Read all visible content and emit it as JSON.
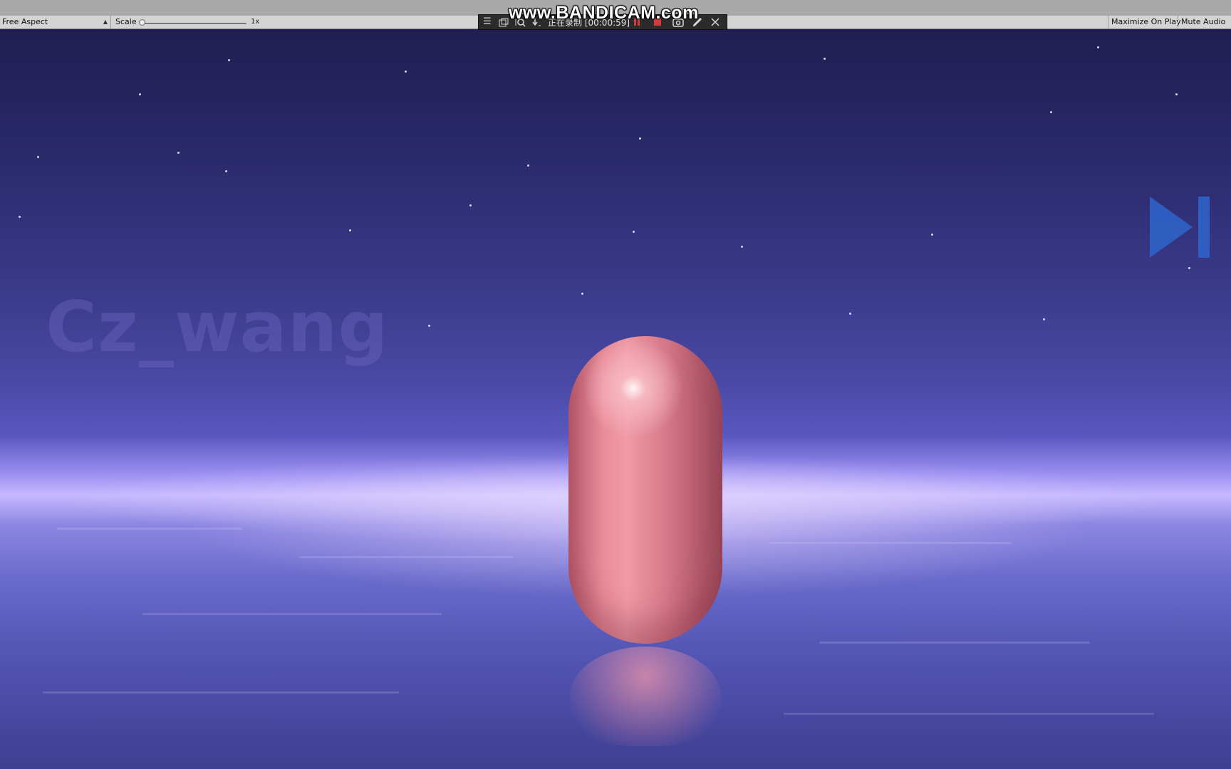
{
  "toolbar": {
    "aspect_label": "Free Aspect",
    "scale_label": "Scale",
    "scale_value": "1x",
    "maximize_label": "Maximize On Play",
    "mute_label": "Mute Audio"
  },
  "recorder": {
    "logo": "www.BANDICAM.com",
    "status": "正在录制 [00:00:59]"
  },
  "scene": {
    "watermark": "Cz_wang"
  },
  "icons": [
    "menu-icon",
    "window-icon",
    "search-icon",
    "download-icon",
    "pause-icon",
    "stop-icon",
    "camera-icon",
    "pen-icon",
    "close-icon",
    "skip-next-icon"
  ],
  "colors": {
    "sky_top": "#201e52",
    "horizon_glow": "#c6b8ff",
    "capsule": "#e98c98",
    "skip_button": "#2f62c8",
    "recording_red": "#d23b3b"
  }
}
